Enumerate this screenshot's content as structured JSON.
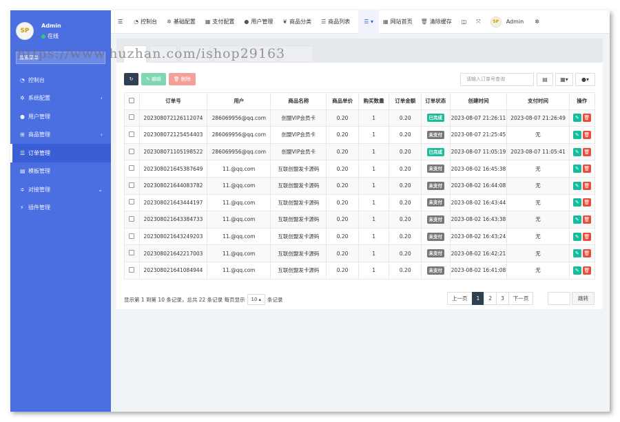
{
  "user": {
    "name": "Admin",
    "status": "在线",
    "logo_text": "SP"
  },
  "sidebar": {
    "search_placeholder": "搜索菜单",
    "items": [
      {
        "label": "控制台",
        "icon": "dashboard-icon",
        "glyph": "◔",
        "has_arrow": false,
        "active": false
      },
      {
        "label": "系统配置",
        "icon": "gear-icon",
        "glyph": "✲",
        "has_arrow": true,
        "arrow": "‹",
        "active": false
      },
      {
        "label": "用户管理",
        "icon": "user-icon",
        "glyph": "●",
        "has_arrow": false,
        "active": false
      },
      {
        "label": "商品管理",
        "icon": "cart-icon",
        "glyph": "⊞",
        "has_arrow": true,
        "arrow": "‹",
        "active": false
      },
      {
        "label": "订单管理",
        "icon": "list-icon",
        "glyph": "☰",
        "has_arrow": false,
        "active": true
      },
      {
        "label": "模板管理",
        "icon": "template-icon",
        "glyph": "▤",
        "has_arrow": false,
        "active": false
      },
      {
        "label": "对接管理",
        "icon": "sliders-icon",
        "glyph": "≑",
        "has_arrow": true,
        "arrow": "⌄",
        "active": false
      },
      {
        "label": "插件管理",
        "icon": "plug-icon",
        "glyph": "⚡",
        "has_arrow": false,
        "active": false
      }
    ]
  },
  "topbar": {
    "menu_toggle": "☰",
    "items": [
      {
        "label": "控制台",
        "icon": "dashboard-icon",
        "glyph": "◔"
      },
      {
        "label": "基础配置",
        "icon": "gear-icon",
        "glyph": "✲"
      },
      {
        "label": "支付配置",
        "icon": "table-icon",
        "glyph": "▦"
      },
      {
        "label": "用户管理",
        "icon": "user-icon",
        "glyph": "●"
      },
      {
        "label": "商品分类",
        "icon": "leaf-icon",
        "glyph": "❦"
      },
      {
        "label": "商品列表",
        "icon": "list-icon",
        "glyph": "☰"
      }
    ],
    "dropdown_glyph": "☰ ▾",
    "site_home": "网站首页",
    "clear_cache": "清除缓存",
    "admin": "Admin"
  },
  "watermark": "https://www.huzhan.com/ishop29163",
  "toolbar": {
    "refresh": "↻",
    "edit": "编辑",
    "delete": "删除"
  },
  "search": {
    "placeholder": "请输入订单号查询"
  },
  "table": {
    "headers": [
      "订单号",
      "用户",
      "商品名称",
      "商品单价",
      "购买数量",
      "订单金额",
      "订单状态",
      "创建时间",
      "支付时间",
      "操作"
    ],
    "rows": [
      {
        "order": "202308072126112074",
        "user": "286069956@qq.com",
        "product": "创盟VIP会员卡",
        "price": "0.20",
        "qty": "1",
        "amount": "0.20",
        "status": "已完成",
        "done": true,
        "created": "2023-08-07 21:26:11",
        "paid": "2023-08-07 21:26:49"
      },
      {
        "order": "202308072125454403",
        "user": "286069956@qq.com",
        "product": "创盟VIP会员卡",
        "price": "0.20",
        "qty": "1",
        "amount": "0.20",
        "status": "未支付",
        "done": false,
        "created": "2023-08-07 21:25:45",
        "paid": "无"
      },
      {
        "order": "202308071105198522",
        "user": "286069956@qq.com",
        "product": "创盟VIP会员卡",
        "price": "0.20",
        "qty": "1",
        "amount": "0.20",
        "status": "已完成",
        "done": true,
        "created": "2023-08-07 11:05:19",
        "paid": "2023-08-07 11:05:41"
      },
      {
        "order": "202308021645387649",
        "user": "11.@qq.com",
        "product": "互联创盟发卡源码",
        "price": "0.20",
        "qty": "1",
        "amount": "0.20",
        "status": "未支付",
        "done": false,
        "created": "2023-08-02 16:45:38",
        "paid": "无"
      },
      {
        "order": "202308021644083782",
        "user": "11.@qq.com",
        "product": "互联创盟发卡源码",
        "price": "0.20",
        "qty": "1",
        "amount": "0.20",
        "status": "未支付",
        "done": false,
        "created": "2023-08-02 16:44:08",
        "paid": "无"
      },
      {
        "order": "202308021643444197",
        "user": "11.@qq.com",
        "product": "互联创盟发卡源码",
        "price": "0.20",
        "qty": "1",
        "amount": "0.20",
        "status": "未支付",
        "done": false,
        "created": "2023-08-02 16:43:44",
        "paid": "无"
      },
      {
        "order": "202308021643384733",
        "user": "11.@qq.com",
        "product": "互联创盟发卡源码",
        "price": "0.20",
        "qty": "1",
        "amount": "0.20",
        "status": "未支付",
        "done": false,
        "created": "2023-08-02 16:43:38",
        "paid": "无"
      },
      {
        "order": "202308021643249203",
        "user": "11.@qq.com",
        "product": "互联创盟发卡源码",
        "price": "0.20",
        "qty": "1",
        "amount": "0.20",
        "status": "未支付",
        "done": false,
        "created": "2023-08-02 16:43:24",
        "paid": "无"
      },
      {
        "order": "202308021642217003",
        "user": "11.@qq.com",
        "product": "互联创盟发卡源码",
        "price": "0.20",
        "qty": "1",
        "amount": "0.20",
        "status": "未支付",
        "done": false,
        "created": "2023-08-02 16:42:21",
        "paid": "无"
      },
      {
        "order": "202308021641084944",
        "user": "11.@qq.com",
        "product": "互联创盟发卡源码",
        "price": "0.20",
        "qty": "1",
        "amount": "0.20",
        "status": "未支付",
        "done": false,
        "created": "2023-08-02 16:41:08",
        "paid": "无"
      }
    ]
  },
  "footer": {
    "summary": "显示第 1 到第 10 条记录，总共 22 条记录 每页显示",
    "page_size": "10",
    "suffix": "条记录"
  },
  "pager": {
    "prev": "上一页",
    "pages": [
      "1",
      "2",
      "3"
    ],
    "current": "1",
    "next": "下一页",
    "jump": "跳转"
  },
  "colors": {
    "sidebar": "#4b6fe0",
    "active_menu": "#3a5ed6",
    "done": "#1abc9c",
    "unpaid": "#777777",
    "edit": "#18bc9c",
    "delete": "#e74c3c",
    "dark": "#2f4050"
  }
}
